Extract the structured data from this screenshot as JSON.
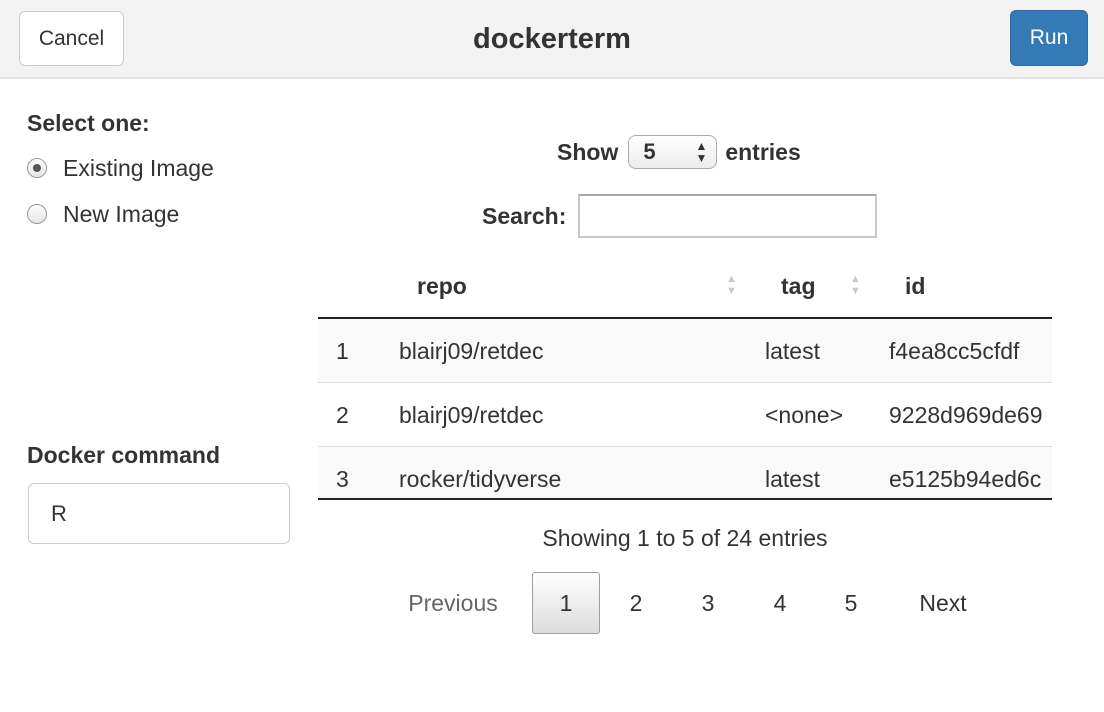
{
  "topbar": {
    "cancel_label": "Cancel",
    "title": "dockerterm",
    "run_label": "Run",
    "accent_color": "#337ab7"
  },
  "image_choice": {
    "label": "Select one:",
    "options": [
      {
        "label": "Existing Image",
        "selected": true
      },
      {
        "label": "New Image",
        "selected": false
      }
    ]
  },
  "command": {
    "label": "Docker command",
    "value": "R"
  },
  "table_controls": {
    "show_prefix": "Show",
    "page_length": "5",
    "show_suffix": "entries",
    "search_label": "Search:",
    "search_value": ""
  },
  "table": {
    "columns": [
      "repo",
      "tag",
      "id"
    ],
    "rows": [
      {
        "index": "1",
        "repo": "blairj09/retdec",
        "tag": "latest",
        "id": "f4ea8cc5cfdf"
      },
      {
        "index": "2",
        "repo": "blairj09/retdec",
        "tag": "<none>",
        "id": "9228d969de69"
      },
      {
        "index": "3",
        "repo": "rocker/tidyverse",
        "tag": "latest",
        "id": "e5125b94ed6c"
      }
    ]
  },
  "info": "Showing 1 to 5 of 24 entries",
  "pagination": {
    "previous": "Previous",
    "pages": [
      "1",
      "2",
      "3",
      "4",
      "5"
    ],
    "current": "1",
    "next": "Next"
  }
}
